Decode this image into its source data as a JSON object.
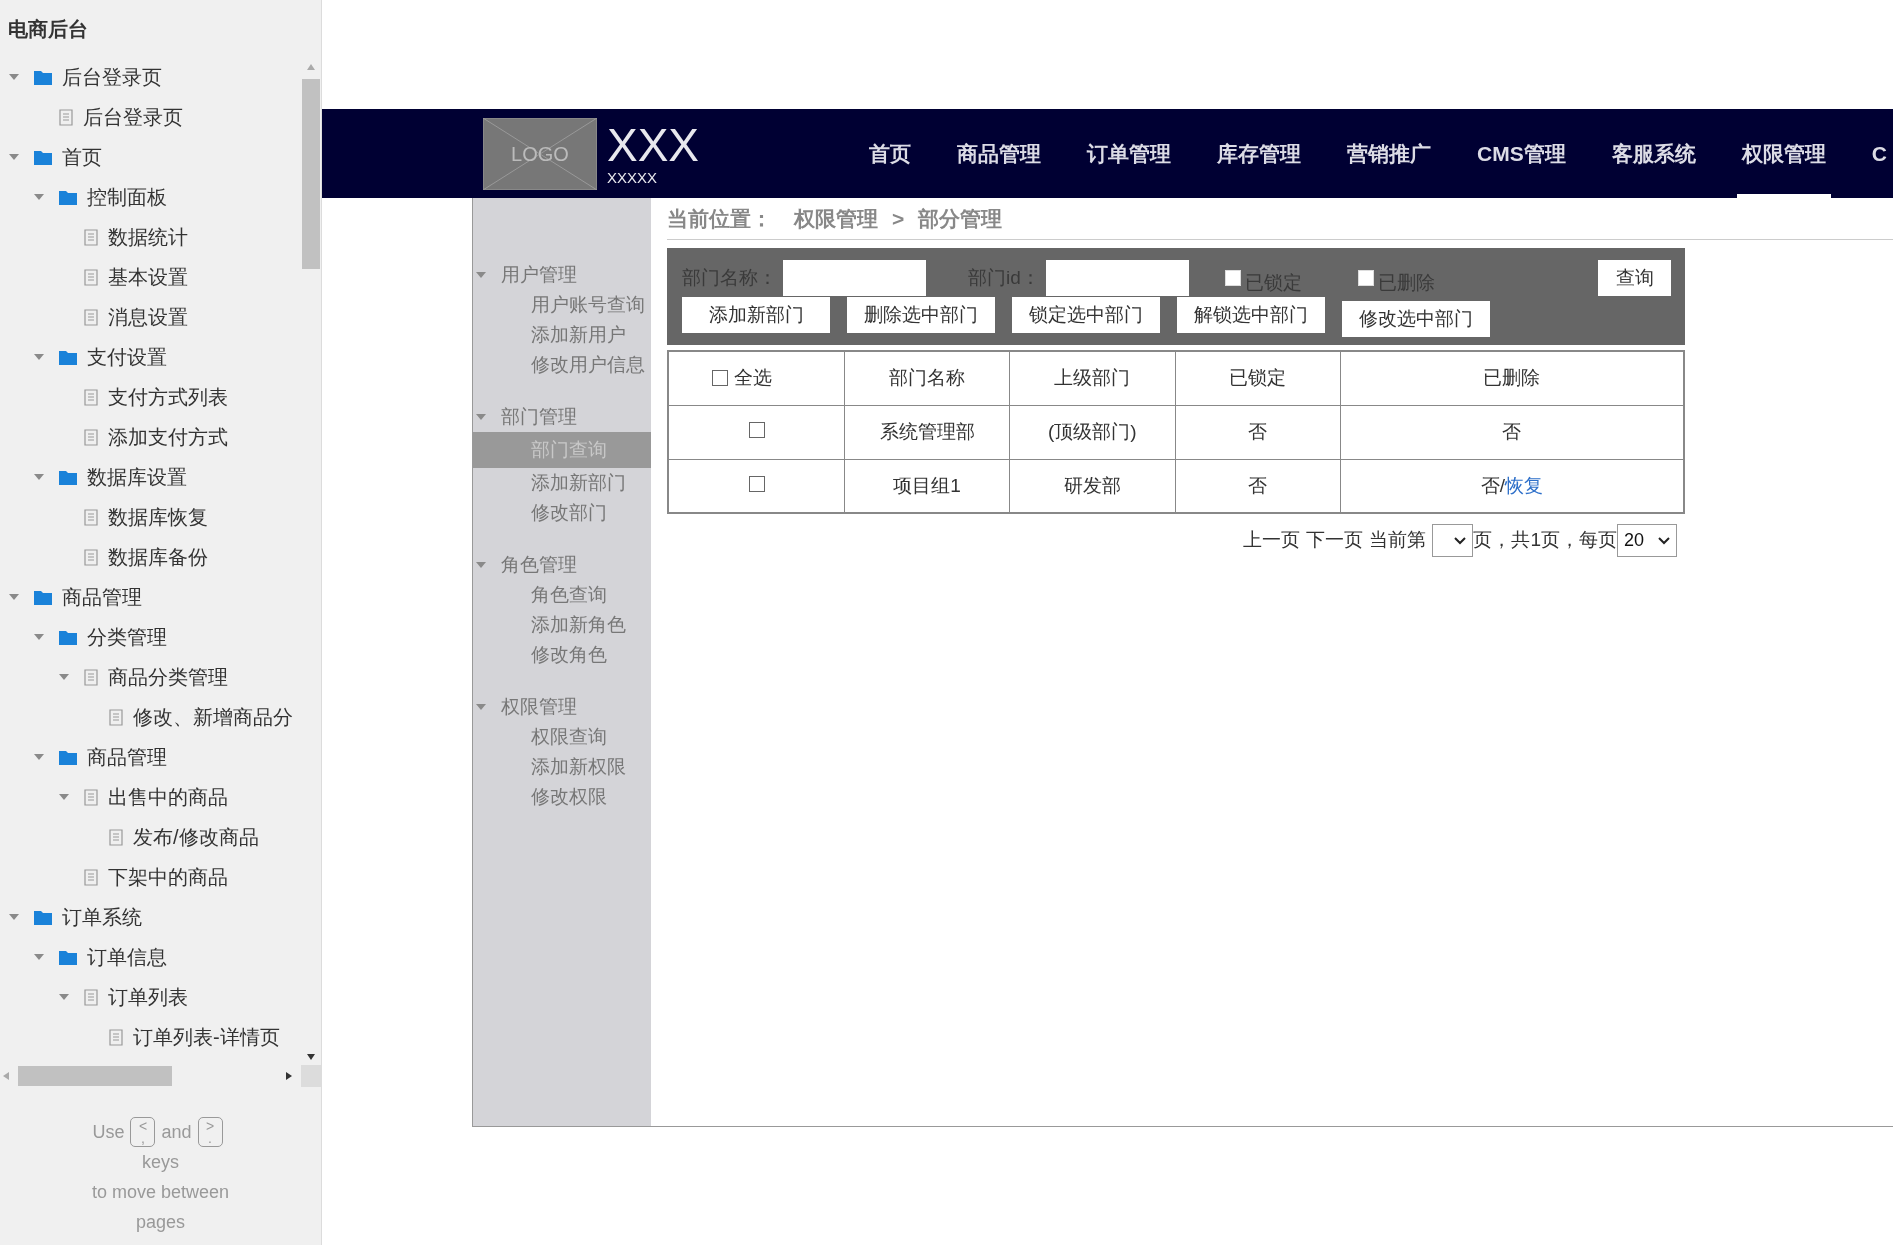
{
  "sidebar": {
    "title": "电商后台",
    "tree": [
      {
        "label": "后台登录页",
        "kind": "folder",
        "expanded": true,
        "children": [
          {
            "label": "后台登录页",
            "kind": "page"
          }
        ]
      },
      {
        "label": "首页",
        "kind": "folder",
        "expanded": true,
        "children": [
          {
            "label": "控制面板",
            "kind": "folder",
            "expanded": true,
            "children": [
              {
                "label": "数据统计",
                "kind": "page"
              },
              {
                "label": "基本设置",
                "kind": "page"
              },
              {
                "label": "消息设置",
                "kind": "page"
              }
            ]
          },
          {
            "label": "支付设置",
            "kind": "folder",
            "expanded": true,
            "children": [
              {
                "label": "支付方式列表",
                "kind": "page"
              },
              {
                "label": "添加支付方式",
                "kind": "page"
              }
            ]
          },
          {
            "label": "数据库设置",
            "kind": "folder",
            "expanded": true,
            "children": [
              {
                "label": "数据库恢复",
                "kind": "page"
              },
              {
                "label": "数据库备份",
                "kind": "page"
              }
            ]
          }
        ]
      },
      {
        "label": "商品管理",
        "kind": "folder",
        "expanded": true,
        "children": [
          {
            "label": "分类管理",
            "kind": "folder",
            "expanded": true,
            "children": [
              {
                "label": "商品分类管理",
                "kind": "page",
                "expanded": true,
                "children": [
                  {
                    "label": "修改、新增商品分",
                    "kind": "page"
                  }
                ]
              }
            ]
          },
          {
            "label": "商品管理",
            "kind": "folder",
            "expanded": true,
            "children": [
              {
                "label": "出售中的商品",
                "kind": "page",
                "expanded": true,
                "children": [
                  {
                    "label": "发布/修改商品",
                    "kind": "page"
                  }
                ]
              },
              {
                "label": "下架中的商品",
                "kind": "page"
              }
            ]
          }
        ]
      },
      {
        "label": "订单系统",
        "kind": "folder",
        "expanded": true,
        "children": [
          {
            "label": "订单信息",
            "kind": "folder",
            "expanded": true,
            "children": [
              {
                "label": "订单列表",
                "kind": "page",
                "expanded": true,
                "children": [
                  {
                    "label": "订单列表-详情页",
                    "kind": "page"
                  }
                ]
              }
            ]
          }
        ]
      }
    ],
    "hint": {
      "use": "Use",
      "key_prev": {
        "top": "<",
        "bottom": ","
      },
      "and": "and",
      "key_next": {
        "top": ">",
        "bottom": "."
      },
      "lines": [
        "keys",
        "to move between",
        "pages"
      ]
    }
  },
  "header": {
    "logo": "LOGO",
    "brand": "XXX",
    "subtitle": "XXXXX",
    "nav": [
      {
        "label": "首页",
        "selected": false
      },
      {
        "label": "商品管理",
        "selected": false
      },
      {
        "label": "订单管理",
        "selected": false
      },
      {
        "label": "库存管理",
        "selected": false
      },
      {
        "label": "营销推广",
        "selected": false
      },
      {
        "label": "CMS管理",
        "selected": false
      },
      {
        "label": "客服系统",
        "selected": false
      },
      {
        "label": "权限管理",
        "selected": true
      },
      {
        "label": "C",
        "selected": false
      }
    ]
  },
  "side_menu": [
    {
      "label": "用户管理",
      "expanded": true,
      "items": [
        {
          "label": "用户账号查询",
          "selected": false
        },
        {
          "label": "添加新用户",
          "selected": false
        },
        {
          "label": "修改用户信息",
          "selected": false
        }
      ]
    },
    {
      "label": "部门管理",
      "expanded": true,
      "items": [
        {
          "label": "部门查询",
          "selected": true
        },
        {
          "label": "添加新部门",
          "selected": false
        },
        {
          "label": "修改部门",
          "selected": false
        }
      ]
    },
    {
      "label": "角色管理",
      "expanded": true,
      "items": [
        {
          "label": "角色查询",
          "selected": false
        },
        {
          "label": "添加新角色",
          "selected": false
        },
        {
          "label": "修改角色",
          "selected": false
        }
      ]
    },
    {
      "label": "权限管理",
      "expanded": true,
      "items": [
        {
          "label": "权限查询",
          "selected": false
        },
        {
          "label": "添加新权限",
          "selected": false
        },
        {
          "label": "修改权限",
          "selected": false
        }
      ]
    }
  ],
  "breadcrumb": {
    "label": "当前位置：",
    "path": [
      "权限管理",
      "部分管理"
    ],
    "separator": ">"
  },
  "filter": {
    "fields": [
      {
        "label": "部门名称："
      },
      {
        "label": "部门id："
      }
    ],
    "checkboxes": [
      {
        "label": "已锁定",
        "checked": false
      },
      {
        "label": "已删除",
        "checked": false
      }
    ],
    "search_button": "查询",
    "actions": [
      "添加新部门",
      "删除选中部门",
      "锁定选中部门",
      "解锁选中部门",
      "修改选中部门"
    ]
  },
  "table": {
    "select_all": {
      "label": "全选",
      "checked": false
    },
    "columns": [
      "部门名称",
      "上级部门",
      "已锁定",
      "已删除"
    ],
    "rows": [
      {
        "checked": false,
        "cells": [
          "系统管理部",
          "(顶级部门)",
          "否",
          "否"
        ]
      },
      {
        "checked": false,
        "cells": [
          "项目组1",
          "研发部",
          "否",
          {
            "text": "否/",
            "link": "恢复"
          }
        ]
      }
    ]
  },
  "pagination": {
    "prev": "上一页",
    "next": "下一页",
    "current_label": "当前第",
    "total_text": "页，共1页，每页",
    "page_size": "20"
  }
}
